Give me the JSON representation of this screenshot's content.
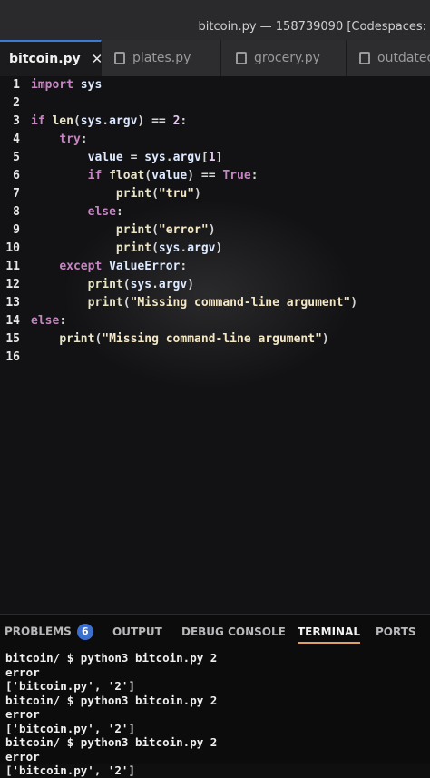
{
  "window": {
    "title": "bitcoin.py — 158739090 [Codespaces:"
  },
  "tabs": [
    {
      "label": "bitcoin.py",
      "active": true,
      "close": "✕"
    },
    {
      "label": "plates.py",
      "active": false
    },
    {
      "label": "grocery.py",
      "active": false
    },
    {
      "label": "outdatec",
      "active": false
    }
  ],
  "editor": {
    "lines": [
      {
        "n": "1",
        "tokens": [
          [
            "kw",
            "import"
          ],
          [
            "op",
            " "
          ],
          [
            "var",
            "sys"
          ]
        ]
      },
      {
        "n": "2",
        "tokens": []
      },
      {
        "n": "3",
        "tokens": [
          [
            "kw",
            "if"
          ],
          [
            "op",
            " "
          ],
          [
            "fn",
            "len"
          ],
          [
            "op",
            "("
          ],
          [
            "var",
            "sys"
          ],
          [
            "op",
            "."
          ],
          [
            "var",
            "argv"
          ],
          [
            "op",
            ") == "
          ],
          [
            "num",
            "2"
          ],
          [
            "op",
            ":"
          ]
        ]
      },
      {
        "n": "4",
        "tokens": [
          [
            "op",
            "    "
          ],
          [
            "kw",
            "try"
          ],
          [
            "op",
            ":"
          ]
        ]
      },
      {
        "n": "5",
        "tokens": [
          [
            "op",
            "        "
          ],
          [
            "var",
            "value"
          ],
          [
            "op",
            " = "
          ],
          [
            "var",
            "sys"
          ],
          [
            "op",
            "."
          ],
          [
            "var",
            "argv"
          ],
          [
            "op",
            "["
          ],
          [
            "num",
            "1"
          ],
          [
            "op",
            "]"
          ]
        ]
      },
      {
        "n": "6",
        "tokens": [
          [
            "op",
            "        "
          ],
          [
            "kw",
            "if"
          ],
          [
            "op",
            " "
          ],
          [
            "fn",
            "float"
          ],
          [
            "op",
            "("
          ],
          [
            "var",
            "value"
          ],
          [
            "op",
            ") == "
          ],
          [
            "kw",
            "True"
          ],
          [
            "op",
            ":"
          ]
        ]
      },
      {
        "n": "7",
        "tokens": [
          [
            "op",
            "            "
          ],
          [
            "fn",
            "print"
          ],
          [
            "op",
            "("
          ],
          [
            "str",
            "\"tru\""
          ],
          [
            "op",
            ")"
          ]
        ]
      },
      {
        "n": "8",
        "tokens": [
          [
            "op",
            "        "
          ],
          [
            "kw",
            "else"
          ],
          [
            "op",
            ":"
          ]
        ]
      },
      {
        "n": "9",
        "tokens": [
          [
            "op",
            "            "
          ],
          [
            "fn",
            "print"
          ],
          [
            "op",
            "("
          ],
          [
            "str",
            "\"error\""
          ],
          [
            "op",
            ")"
          ]
        ]
      },
      {
        "n": "10",
        "tokens": [
          [
            "op",
            "            "
          ],
          [
            "fn",
            "print"
          ],
          [
            "op",
            "("
          ],
          [
            "var",
            "sys"
          ],
          [
            "op",
            "."
          ],
          [
            "var",
            "argv"
          ],
          [
            "op",
            ")"
          ]
        ]
      },
      {
        "n": "11",
        "tokens": [
          [
            "op",
            "    "
          ],
          [
            "kw",
            "except"
          ],
          [
            "op",
            " "
          ],
          [
            "var",
            "ValueError"
          ],
          [
            "op",
            ":"
          ]
        ]
      },
      {
        "n": "12",
        "tokens": [
          [
            "op",
            "        "
          ],
          [
            "fn",
            "print"
          ],
          [
            "op",
            "("
          ],
          [
            "var",
            "sys"
          ],
          [
            "op",
            "."
          ],
          [
            "var",
            "argv"
          ],
          [
            "op",
            ")"
          ]
        ]
      },
      {
        "n": "13",
        "tokens": [
          [
            "op",
            "        "
          ],
          [
            "fn",
            "print"
          ],
          [
            "op",
            "("
          ],
          [
            "str",
            "\"Missing command-line argument\""
          ],
          [
            "op",
            ")"
          ]
        ]
      },
      {
        "n": "14",
        "tokens": [
          [
            "kw",
            "else"
          ],
          [
            "op",
            ":"
          ]
        ]
      },
      {
        "n": "15",
        "tokens": [
          [
            "op",
            "    "
          ],
          [
            "fn",
            "print"
          ],
          [
            "op",
            "("
          ],
          [
            "str",
            "\"Missing command-line argument\""
          ],
          [
            "op",
            ")"
          ]
        ]
      },
      {
        "n": "16",
        "tokens": []
      }
    ]
  },
  "panel": {
    "tabs": [
      {
        "label": "PROBLEMS",
        "badge": "6",
        "active": false
      },
      {
        "label": "OUTPUT",
        "active": false
      },
      {
        "label": "DEBUG CONSOLE",
        "active": false
      },
      {
        "label": "TERMINAL",
        "active": true
      },
      {
        "label": "PORTS",
        "active": false
      }
    ],
    "terminal": [
      "bitcoin/ $ python3 bitcoin.py 2",
      "error",
      "['bitcoin.py', '2']",
      "bitcoin/ $ python3 bitcoin.py 2",
      "error",
      "['bitcoin.py', '2']",
      "bitcoin/ $ python3 bitcoin.py 2",
      "error",
      "['bitcoin.py', '2']"
    ]
  },
  "colors": {
    "accent": "#3a7bd5",
    "badge": "#3b6fd0",
    "terminal_underline": "#e0a060"
  }
}
